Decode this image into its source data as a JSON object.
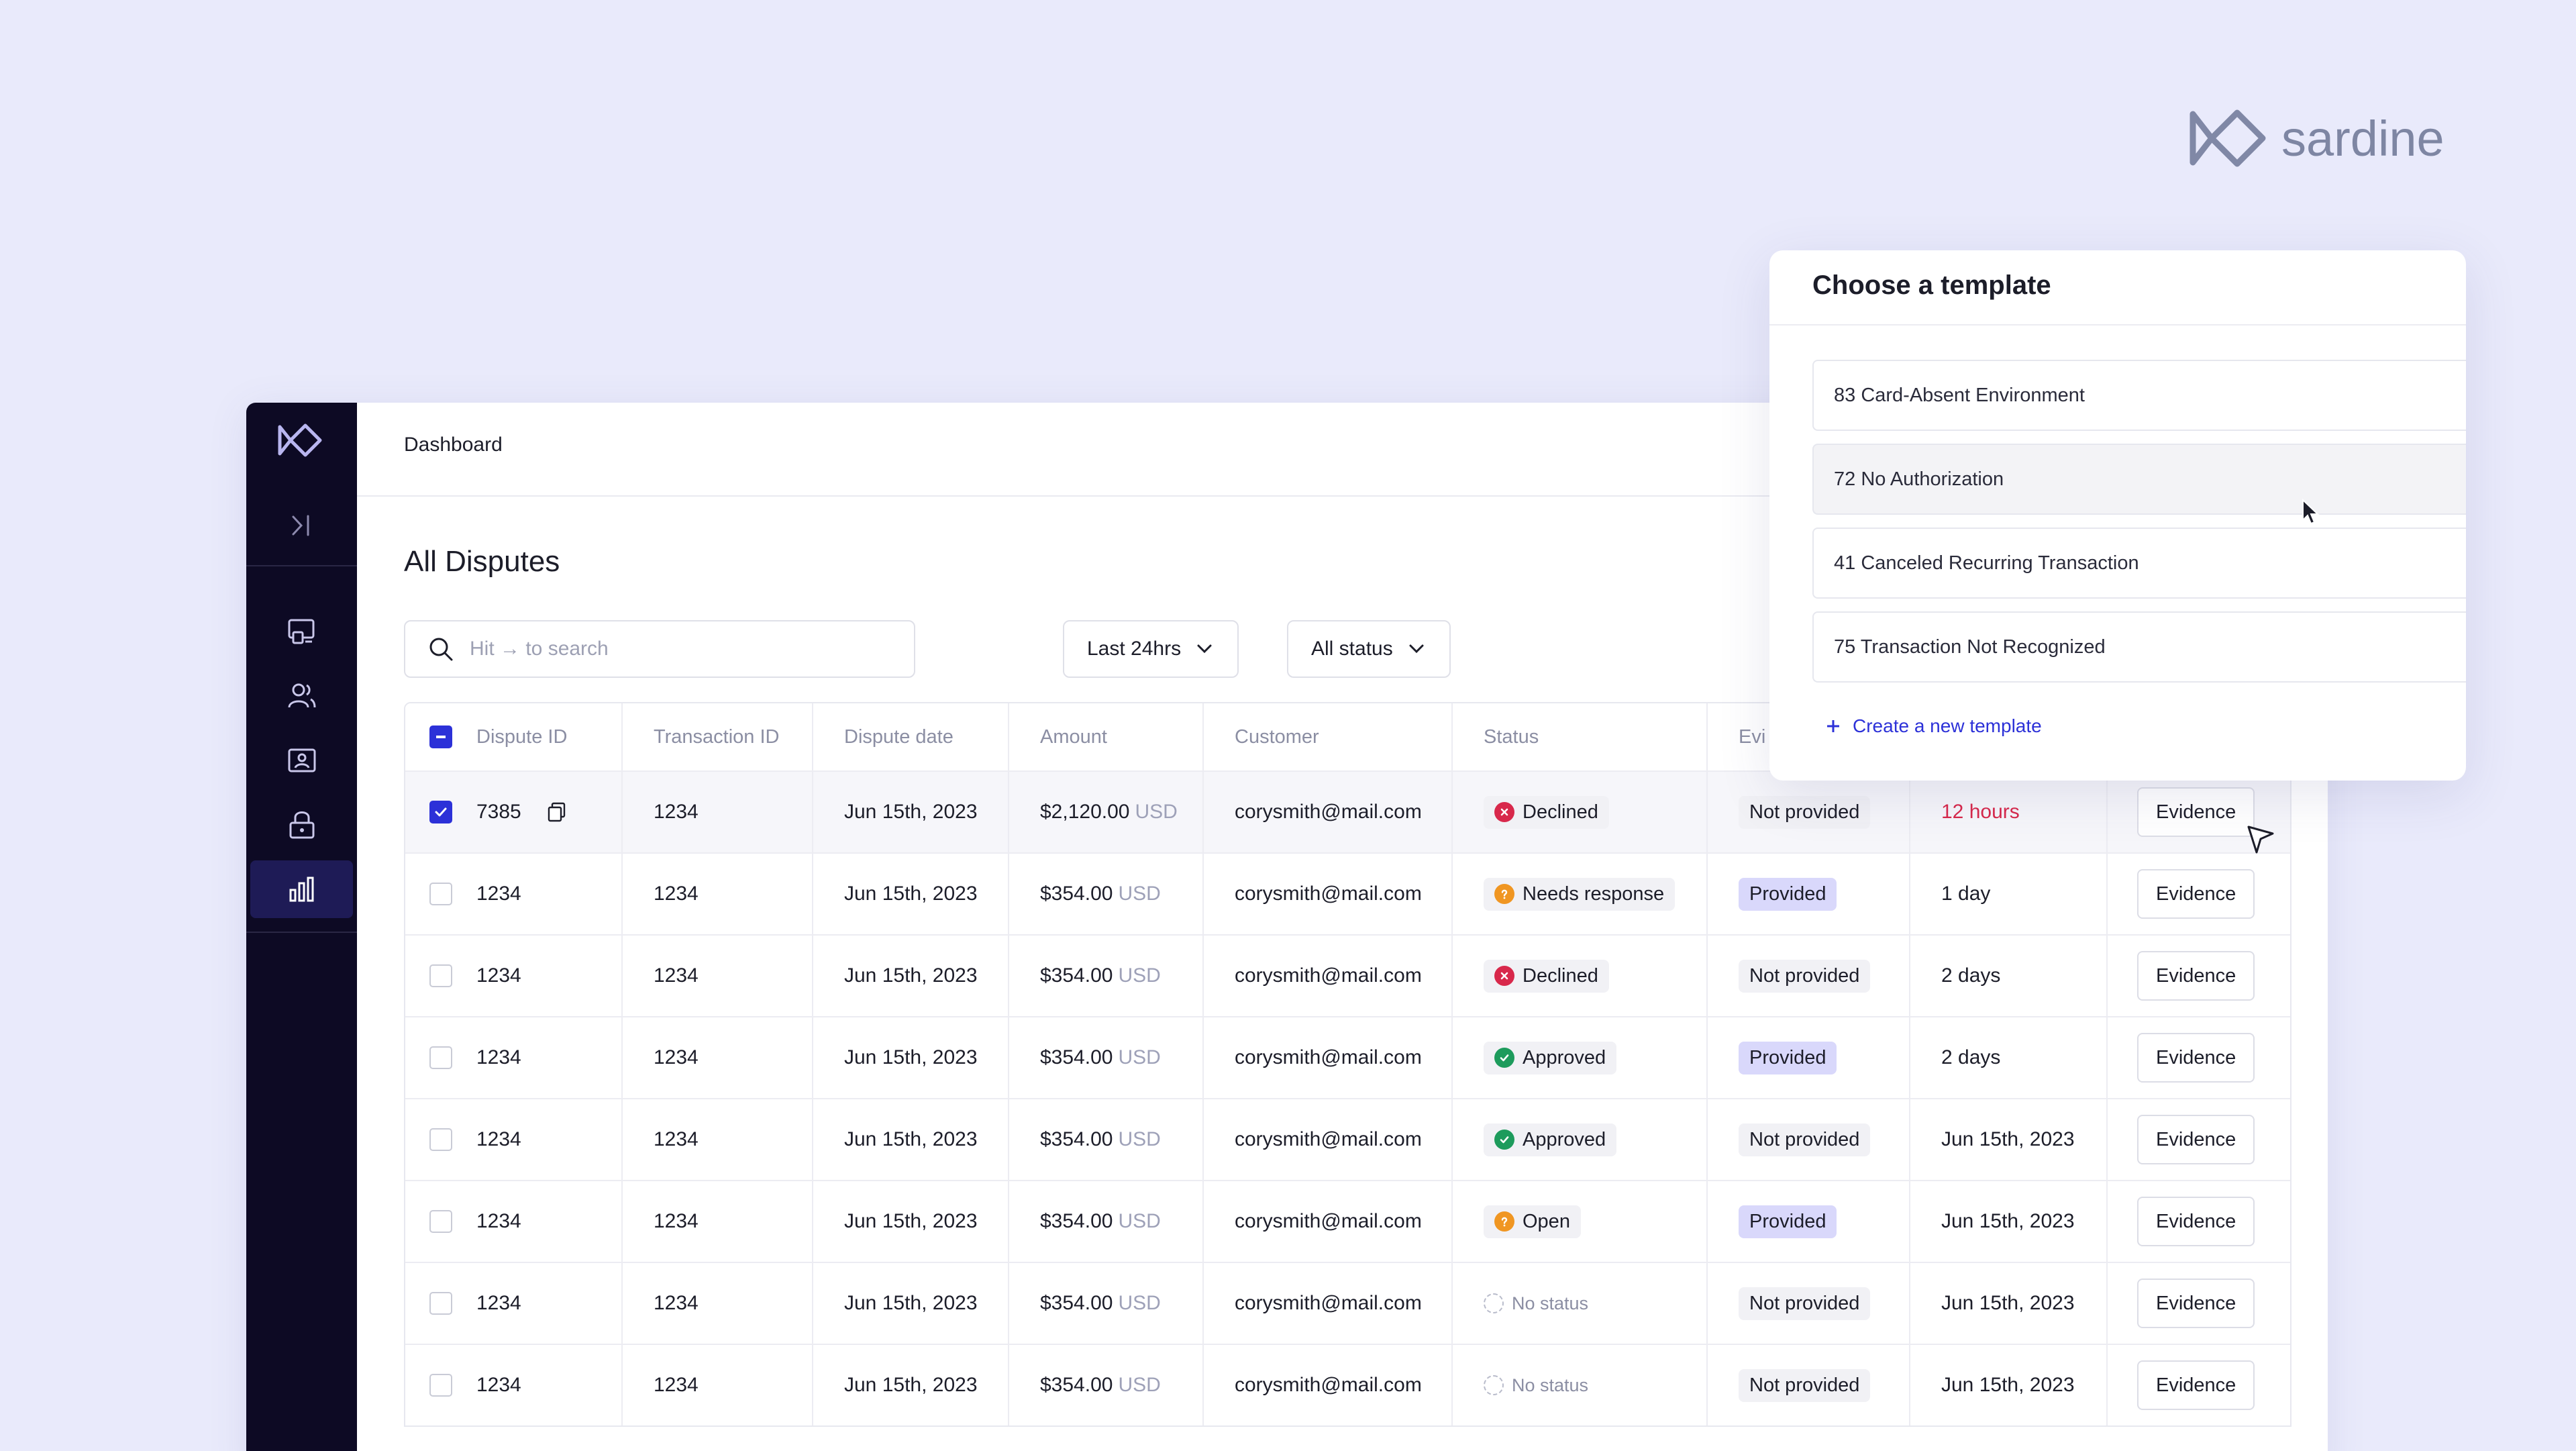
{
  "brand": {
    "name": "sardine"
  },
  "topbar": {
    "breadcrumb": "Dashboard"
  },
  "page": {
    "title": "All Disputes"
  },
  "search": {
    "placeholder": "Hit → to search"
  },
  "filters": {
    "range": "Last 24hrs",
    "status": "All status"
  },
  "table": {
    "headers": [
      "Dispute ID",
      "Transaction ID",
      "Dispute date",
      "Amount",
      "Customer",
      "Status",
      "Evi"
    ],
    "rows": [
      {
        "id": "7385",
        "txn": "1234",
        "date": "Jun 15th, 2023",
        "amount": "$2,120.00",
        "currency": "USD",
        "customer": "corysmith@mail.com",
        "status": "Declined",
        "evidence": "Not provided",
        "due": "12 hours",
        "action": "Evidence"
      },
      {
        "id": "1234",
        "txn": "1234",
        "date": "Jun 15th, 2023",
        "amount": "$354.00",
        "currency": "USD",
        "customer": "corysmith@mail.com",
        "status": "Needs response",
        "evidence": "Provided",
        "due": "1 day",
        "action": "Evidence"
      },
      {
        "id": "1234",
        "txn": "1234",
        "date": "Jun 15th, 2023",
        "amount": "$354.00",
        "currency": "USD",
        "customer": "corysmith@mail.com",
        "status": "Declined",
        "evidence": "Not provided",
        "due": "2 days",
        "action": "Evidence"
      },
      {
        "id": "1234",
        "txn": "1234",
        "date": "Jun 15th, 2023",
        "amount": "$354.00",
        "currency": "USD",
        "customer": "corysmith@mail.com",
        "status": "Approved",
        "evidence": "Provided",
        "due": "2 days",
        "action": "Evidence"
      },
      {
        "id": "1234",
        "txn": "1234",
        "date": "Jun 15th, 2023",
        "amount": "$354.00",
        "currency": "USD",
        "customer": "corysmith@mail.com",
        "status": "Approved",
        "evidence": "Not provided",
        "due": "Jun 15th, 2023",
        "action": "Evidence"
      },
      {
        "id": "1234",
        "txn": "1234",
        "date": "Jun 15th, 2023",
        "amount": "$354.00",
        "currency": "USD",
        "customer": "corysmith@mail.com",
        "status": "Open",
        "evidence": "Provided",
        "due": "Jun 15th, 2023",
        "action": "Evidence"
      },
      {
        "id": "1234",
        "txn": "1234",
        "date": "Jun 15th, 2023",
        "amount": "$354.00",
        "currency": "USD",
        "customer": "corysmith@mail.com",
        "status": "No status",
        "evidence": "Not provided",
        "due": "Jun 15th, 2023",
        "action": "Evidence"
      },
      {
        "id": "1234",
        "txn": "1234",
        "date": "Jun 15th, 2023",
        "amount": "$354.00",
        "currency": "USD",
        "customer": "corysmith@mail.com",
        "status": "No status",
        "evidence": "Not provided",
        "due": "Jun 15th, 2023",
        "action": "Evidence"
      }
    ]
  },
  "template_popover": {
    "title": "Choose a template",
    "items": [
      "83 Card-Absent Environment",
      "72 No Authorization",
      "41 Canceled Recurring Transaction",
      "75 Transaction Not Recognized"
    ],
    "create_label": "Create a new template"
  },
  "colors": {
    "background": "#E9EAFB",
    "sidebar": "#0d0a24",
    "accent": "#2c31d8",
    "declined": "#d8284b",
    "needs_response": "#f09622",
    "approved": "#1d9b5c",
    "provided_tag": "#d9d8fb"
  },
  "icons": {
    "sidebar": [
      "sardine-logo-icon",
      "collapse-sidebar-icon",
      "dashboard-icon",
      "users-icon",
      "id-card-icon",
      "lock-icon",
      "analytics-icon"
    ]
  }
}
